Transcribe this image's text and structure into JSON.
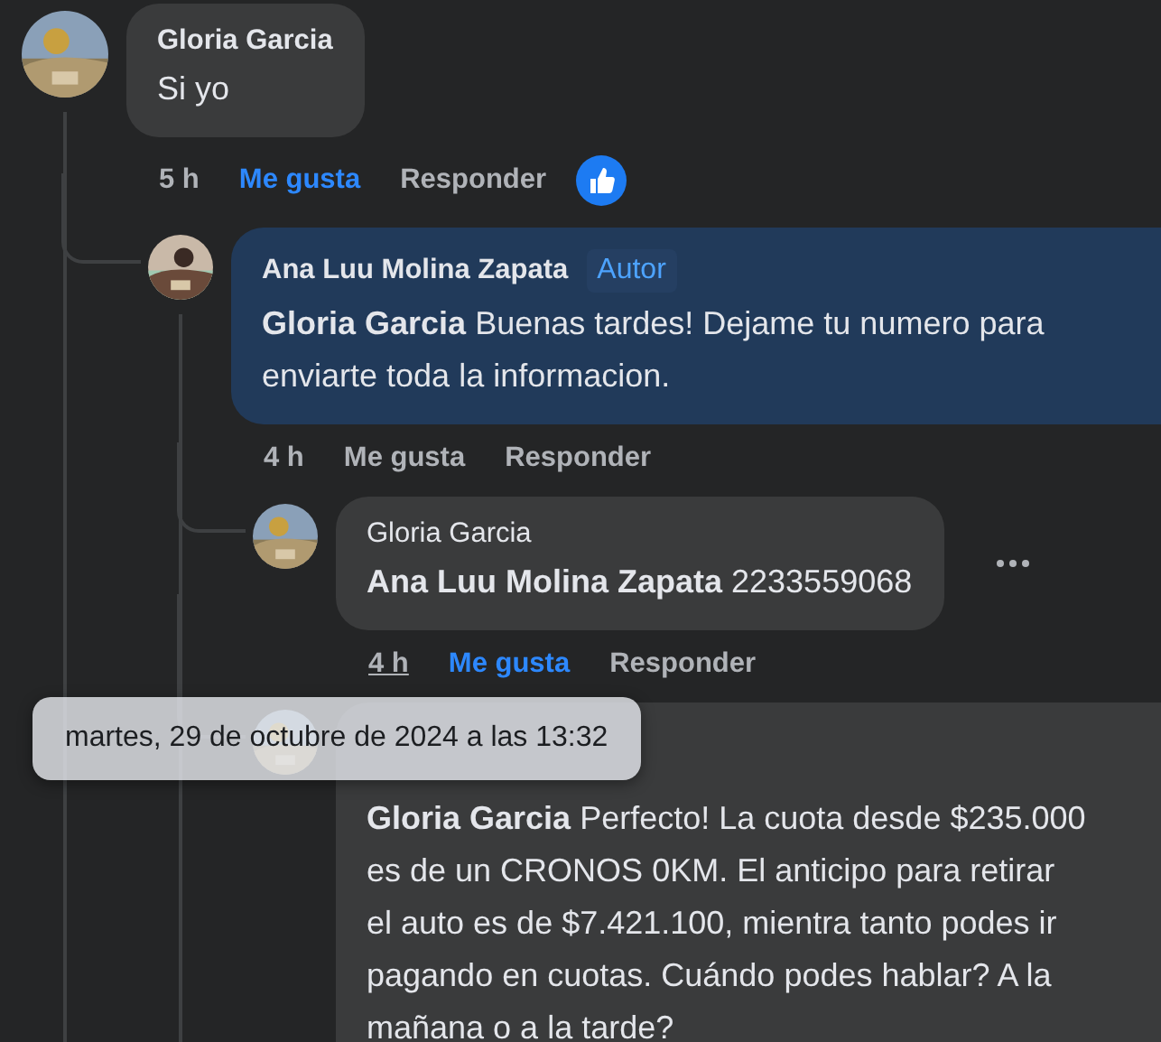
{
  "comments": [
    {
      "author": "Gloria Garcia",
      "text": "Si yo",
      "time": "5 h",
      "like_label": "Me gusta",
      "reply_label": "Responder",
      "liked": true,
      "like_reaction": true,
      "children": [
        {
          "author": "Ana Luu Molina Zapata",
          "badge": "Autor",
          "text": "**Gloria Garcia** Buenas tardes! Dejame tu numero para enviarte toda la informacion.",
          "time": "4 h",
          "like_label": "Me gusta",
          "reply_label": "Responder",
          "liked": false,
          "children": [
            {
              "author": "Gloria Garcia",
              "text": "**Ana Luu Molina Zapata** 2233559068",
              "time": "4 h",
              "time_hovered": true,
              "like_label": "Me gusta",
              "reply_label": "Responder",
              "liked": true,
              "menu_visible": true
            },
            {
              "text": "**Gloria Garcia** Perfecto! La cuota desde $235.000 es de un CRONOS 0KM. El anticipo para retirar el auto es de $7.421.100, mientra tanto podes ir pagando en cuotas. Cuándo podes hablar? A la mañana o a la tarde?"
            }
          ]
        }
      ]
    }
  ],
  "tooltip": {
    "text": "martes, 29 de octubre de 2024 a las 13:32"
  }
}
